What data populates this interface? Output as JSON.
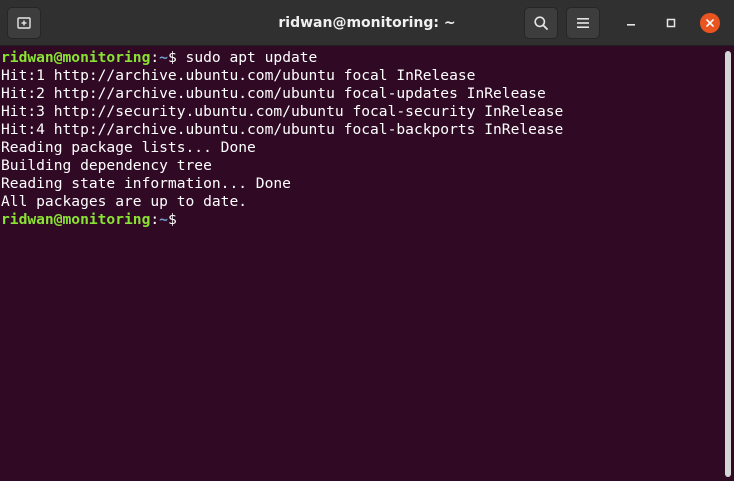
{
  "window": {
    "title": "ridwan@monitoring: ~"
  },
  "headerbar": {
    "new_tab_icon": "new-tab-icon",
    "search_icon": "search-icon",
    "menu_icon": "hamburger-menu-icon",
    "minimize_icon": "minimize-icon",
    "maximize_icon": "maximize-icon",
    "close_icon": "close-icon"
  },
  "colors": {
    "terminal_bg": "#300a24",
    "prompt_user_host": "#8ae234",
    "prompt_cwd": "#729fcf",
    "text": "#ffffff",
    "close_button": "#e95420",
    "headerbar_bg": "#303030"
  },
  "terminal": {
    "prompt": {
      "user_host": "ridwan@monitoring",
      "colon": ":",
      "cwd": "~",
      "symbol": "$ "
    },
    "command": "sudo apt update",
    "output": [
      "Hit:1 http://archive.ubuntu.com/ubuntu focal InRelease",
      "Hit:2 http://archive.ubuntu.com/ubuntu focal-updates InRelease",
      "Hit:3 http://security.ubuntu.com/ubuntu focal-security InRelease",
      "Hit:4 http://archive.ubuntu.com/ubuntu focal-backports InRelease",
      "Reading package lists... Done",
      "Building dependency tree",
      "Reading state information... Done",
      "All packages are up to date."
    ]
  }
}
